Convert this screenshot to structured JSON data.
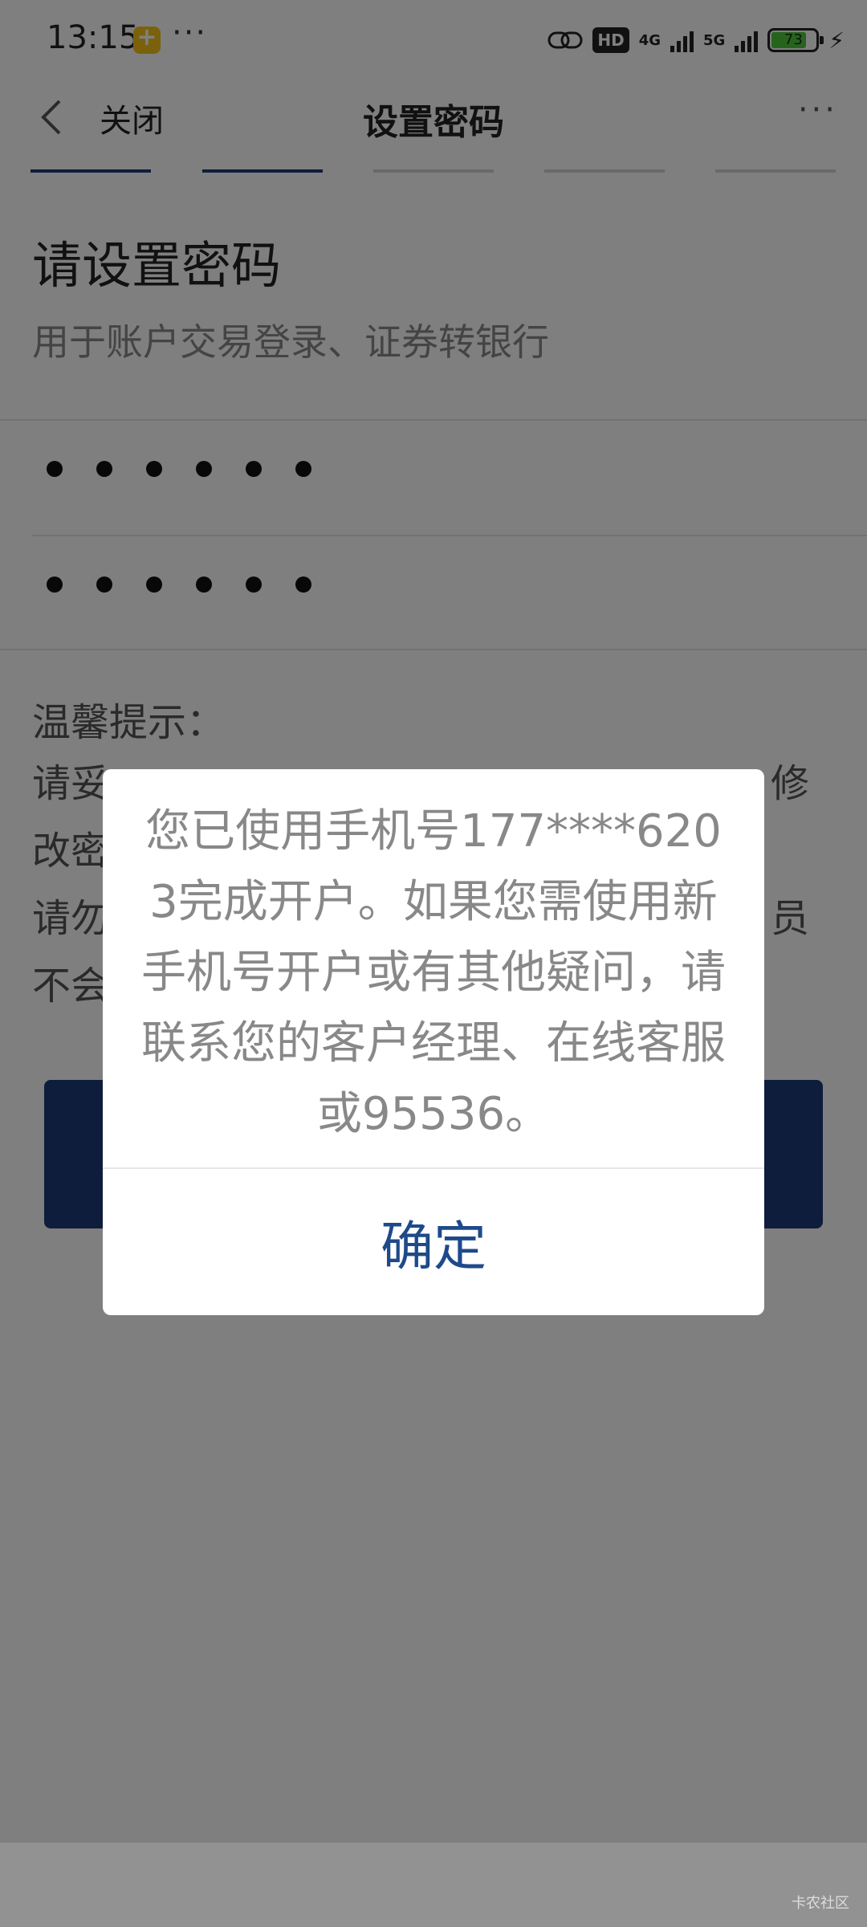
{
  "status_bar": {
    "time": "13:15",
    "notification_icon": "app-notification-icon",
    "more_indicator": "···",
    "hd_badge": "HD",
    "network_4g": "4G",
    "network_5g": "5G",
    "battery_level": "73",
    "battery_fill_fraction": 0.73,
    "battery_color": "#4cc93a"
  },
  "nav": {
    "close_label": "关闭",
    "title": "设置密码",
    "more_label": "···"
  },
  "steps": {
    "total": 5,
    "active": 2,
    "active_color": "#1e3a78"
  },
  "page": {
    "heading": "请设置密码",
    "subheading": "用于账户交易登录、证券转银行",
    "password_mask": "●●●●●●",
    "confirm_password_mask": "●●●●●●",
    "tips_title": "温馨提示：",
    "tips_lines_visible": [
      "请妥",
      "修",
      "改密",
      "请勿",
      "员",
      "不会"
    ]
  },
  "dialog": {
    "message": "您已使用手机号177****6203完成开户。如果您需使用新手机号开户或有其他疑问，请联系您的客户经理、在线客服或95536。",
    "confirm_label": "确定",
    "confirm_color": "#1e4a8a"
  },
  "watermark": "卡农社区"
}
